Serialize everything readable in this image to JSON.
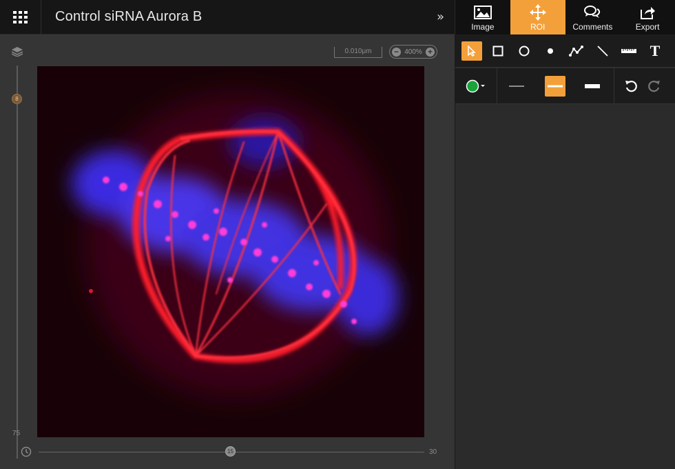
{
  "header": {
    "title": "Control siRNA Aurora B",
    "collapse_label": "»"
  },
  "tabs": [
    {
      "label": "Image",
      "icon": "image-icon",
      "active": false
    },
    {
      "label": "ROI",
      "icon": "roi-move-icon",
      "active": true
    },
    {
      "label": "Comments",
      "icon": "comments-icon",
      "active": false
    },
    {
      "label": "Export",
      "icon": "export-icon",
      "active": false
    }
  ],
  "viewer": {
    "scale_bar": "0.010µm",
    "zoom": "400%",
    "z_slider": {
      "value": "8",
      "max": "75"
    },
    "t_slider": {
      "value": "15",
      "max": "30"
    }
  },
  "roi_tools": {
    "shapes": [
      "select-arrow-icon",
      "rectangle-icon",
      "ellipse-icon",
      "point-icon",
      "polyline-icon",
      "line-icon",
      "ruler-icon",
      "text-tool-icon"
    ],
    "active_tool": "select-arrow-icon",
    "text_tool_glyph": "T",
    "color": "#1aa33a",
    "stroke_widths": [
      "thin",
      "medium",
      "thick"
    ],
    "active_stroke": "medium"
  },
  "colors": {
    "accent": "#f3a03a",
    "header_bg": "#161616",
    "viewer_bg": "#353535"
  }
}
